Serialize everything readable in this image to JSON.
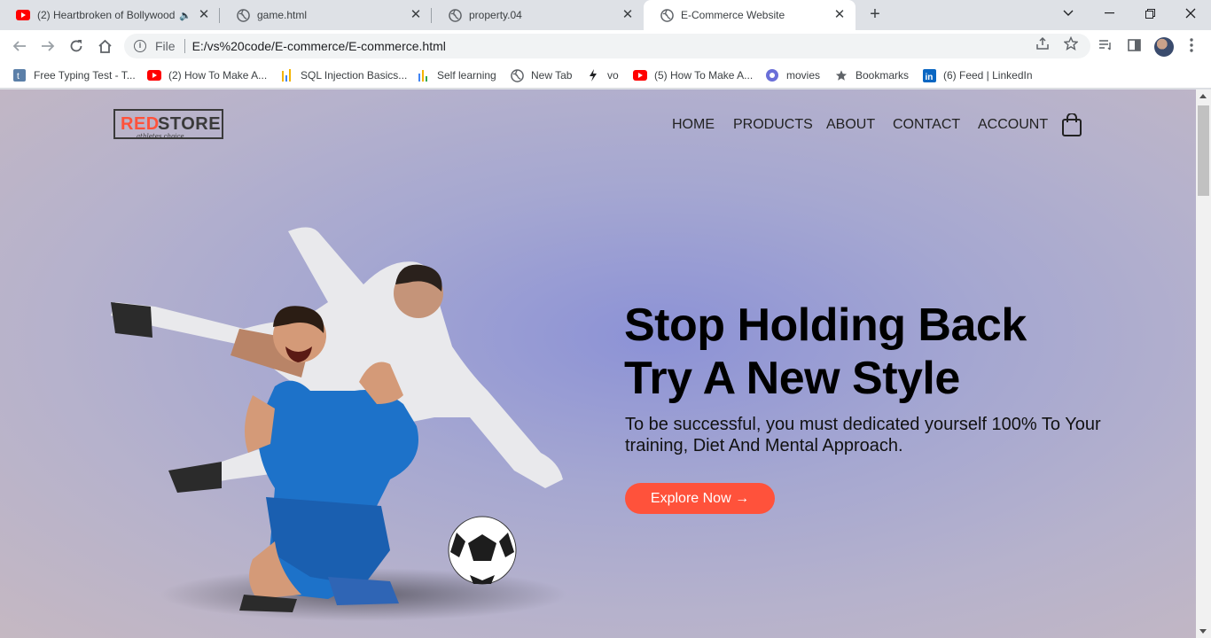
{
  "browser": {
    "tabs": [
      {
        "title": "(2) Heartbroken of Bollywood",
        "icon": "youtube-icon"
      },
      {
        "title": "game.html",
        "icon": "globe-icon"
      },
      {
        "title": "property.04",
        "icon": "globe-icon"
      },
      {
        "title": "E-Commerce Website",
        "icon": "globe-icon"
      }
    ],
    "new_tab_symbol": "+",
    "address": {
      "scheme_label": "File",
      "url": "E:/vs%20code/E-commerce/E-commerce.html"
    },
    "bookmarks": [
      {
        "label": "Free Typing Test - T...",
        "icon": "typing-test-icon"
      },
      {
        "label": "(2) How To Make A...",
        "icon": "youtube-icon"
      },
      {
        "label": "SQL Injection Basics...",
        "icon": "chart-icon"
      },
      {
        "label": "Self learning",
        "icon": "chart-icon"
      },
      {
        "label": "New Tab",
        "icon": "globe-icon"
      },
      {
        "label": "vo",
        "icon": "bolt-icon"
      },
      {
        "label": "(5) How To Make A...",
        "icon": "youtube-icon"
      },
      {
        "label": "movies",
        "icon": "movies-icon"
      },
      {
        "label": "Bookmarks",
        "icon": "star-icon"
      },
      {
        "label": "(6) Feed | LinkedIn",
        "icon": "linkedin-icon"
      }
    ],
    "colors": {
      "tabstrip": "#dee1e6",
      "youtube": "#ff0000",
      "linkedin": "#0a66c2"
    }
  },
  "site": {
    "logo": {
      "red": "RED",
      "rest": "STORE",
      "tagline": "athletes choice"
    },
    "nav": [
      "HOME",
      "PRODUCTS",
      "ABOUT",
      "CONTACT",
      "ACCOUNT"
    ],
    "cart_icon": "shopping-bag-icon",
    "hero": {
      "headline_line1": "Stop Holding Back",
      "headline_line2": "Try A New Style",
      "subtext": "To be successful, you must dedicated yourself 100% To Your training, Diet And Mental Approach.",
      "button": "Explore Now →"
    },
    "colors": {
      "accent": "#ff523b",
      "text": "#000000"
    }
  }
}
